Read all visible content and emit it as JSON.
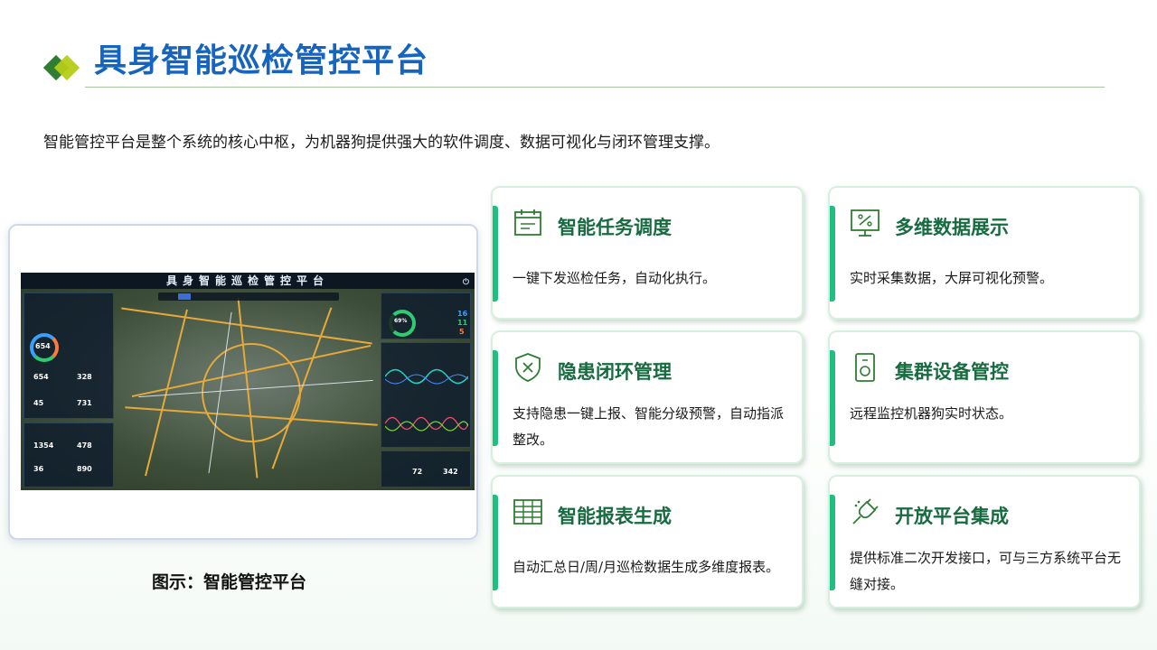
{
  "header": {
    "title": "具身智能巡检管控平台"
  },
  "intro": "智能管控平台是整个系统的核心中枢，为机器狗提供强大的软件调度、数据可视化与闭环管理支撑。",
  "screenshot": {
    "caption": "图示：智能管控平台",
    "dashboard_title": "具身智能巡检管控平台",
    "left_stats": [
      "654",
      "328",
      "45",
      "731"
    ],
    "left_bottom_stats": [
      "1354",
      "478",
      "36",
      "890"
    ],
    "ring_value": "654",
    "right_ring_value": "69%",
    "right_stats": [
      "16",
      "11",
      "5"
    ],
    "right_bottom_stats": [
      "72",
      "342"
    ]
  },
  "cards": [
    {
      "icon": "calendar-icon",
      "title": "智能任务调度",
      "desc": "一键下发巡检任务，自动化执行。"
    },
    {
      "icon": "monitor-percent-icon",
      "title": "多维数据展示",
      "desc": "实时采集数据，大屏可视化预警。"
    },
    {
      "icon": "shield-x-icon",
      "title": "隐患闭环管理",
      "desc": "支持隐患一键上报、智能分级预警，自动指派整改。"
    },
    {
      "icon": "device-speaker-icon",
      "title": "集群设备管控",
      "desc": "远程监控机器狗实时状态。"
    },
    {
      "icon": "table-grid-icon",
      "title": "智能报表生成",
      "desc": "自动汇总日/周/月巡检数据生成多维度报表。"
    },
    {
      "icon": "plug-connect-icon",
      "title": "开放平台集成",
      "desc": "提供标准二次开发接口，可与三方系统平台无缝对接。"
    }
  ],
  "colors": {
    "title_blue": "#1565c0",
    "card_title_green": "#176b40",
    "card_accent": "#1fbf7f",
    "icon_green": "#2e7d32"
  }
}
